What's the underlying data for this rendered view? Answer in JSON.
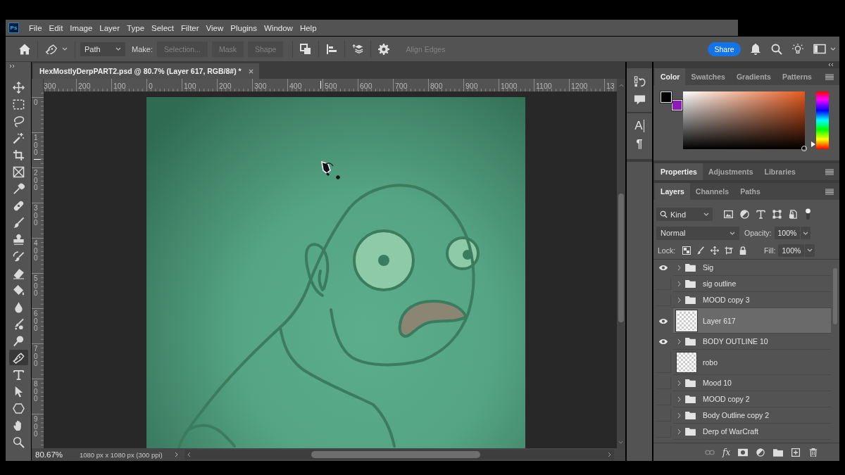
{
  "menu_bar": {
    "logo": "Ps",
    "items": [
      "File",
      "Edit",
      "Image",
      "Layer",
      "Type",
      "Select",
      "Filter",
      "View",
      "Plugins",
      "Window",
      "Help"
    ]
  },
  "options_bar": {
    "mode": "Path",
    "make_label": "Make:",
    "make_buttons": [
      {
        "label": "Selection...",
        "disabled": true
      },
      {
        "label": "Mask",
        "disabled": true
      },
      {
        "label": "Shape",
        "disabled": true
      }
    ],
    "align_edges": {
      "label": "Align Edges",
      "disabled": true
    },
    "share": "Share"
  },
  "tools": [
    {
      "kind": "move",
      "selected": false
    },
    {
      "kind": "marquee",
      "selected": false
    },
    {
      "kind": "lasso",
      "selected": false
    },
    {
      "kind": "wand",
      "selected": false
    },
    {
      "kind": "crop",
      "selected": false
    },
    {
      "kind": "frame",
      "selected": false
    },
    {
      "kind": "eyedropper",
      "selected": false
    },
    {
      "kind": "healing",
      "selected": false
    },
    {
      "kind": "brush",
      "selected": false
    },
    {
      "kind": "stamp",
      "selected": false
    },
    {
      "kind": "history_brush",
      "selected": false
    },
    {
      "kind": "eraser",
      "selected": false
    },
    {
      "kind": "bucket",
      "selected": false
    },
    {
      "kind": "blur",
      "selected": false
    },
    {
      "kind": "smudge",
      "selected": false
    },
    {
      "kind": "dodge",
      "selected": false
    },
    {
      "kind": "pen",
      "selected": true
    },
    {
      "kind": "type",
      "selected": false
    },
    {
      "kind": "path_select",
      "selected": false
    },
    {
      "kind": "shape",
      "selected": false
    },
    {
      "kind": "hand",
      "selected": false
    },
    {
      "kind": "zoom",
      "selected": false
    }
  ],
  "document": {
    "tab": "HexMostlyDerpPART2.psd @ 80.7% (Layer 617, RGB/8#) *",
    "ruler_h": [
      "300",
      "200",
      "100",
      "0",
      "100",
      "200",
      "300",
      "400",
      "500",
      "600",
      "700",
      "800",
      "900",
      "1000",
      "1100",
      "1200",
      "13"
    ],
    "ruler_v": [
      "0",
      "100",
      "200",
      "300",
      "400",
      "500",
      "600",
      "700",
      "800",
      "900"
    ]
  },
  "status_bar": {
    "zoom": "80.67%",
    "info": "1080 px x 1080 px (300 ppi)"
  },
  "panel_strip": [
    {
      "kind": "history"
    },
    {
      "kind": "comments"
    },
    {
      "kind": "character",
      "glyph": "A"
    },
    {
      "kind": "paragraph",
      "glyph": "¶"
    }
  ],
  "color_panel": {
    "tabs": [
      {
        "label": "Color",
        "selected": true
      },
      {
        "label": "Swatches",
        "selected": false
      },
      {
        "label": "Gradients",
        "selected": false
      },
      {
        "label": "Patterns",
        "selected": false
      }
    ],
    "swatches": [
      {
        "kind": "foreground",
        "color": "#000000"
      },
      {
        "kind": "background",
        "color": "#8c1cb8"
      }
    ],
    "hue_slider": {
      "level": 0.08
    }
  },
  "properties_panel": {
    "tabs": [
      {
        "label": "Properties",
        "selected": true
      },
      {
        "label": "Adjustments",
        "selected": false
      },
      {
        "label": "Libraries",
        "selected": false
      }
    ]
  },
  "layers_panel": {
    "tabs": [
      {
        "label": "Layers",
        "selected": true
      },
      {
        "label": "Channels",
        "selected": false
      },
      {
        "label": "Paths",
        "selected": false
      }
    ],
    "filter": "Kind",
    "blend_mode": "Normal",
    "opacity_label": "Opacity:",
    "opacity": "100%",
    "lock_label": "Lock:",
    "fill_label": "Fill:",
    "fill": "100%",
    "layers": [
      {
        "name": "Sig",
        "kind": "group",
        "visible": true,
        "selected": false
      },
      {
        "name": "sig outline",
        "kind": "group",
        "visible": false,
        "selected": false
      },
      {
        "name": "MOOD copy 3",
        "kind": "group",
        "visible": false,
        "selected": false
      },
      {
        "name": "Layer 617",
        "kind": "pixel",
        "visible": true,
        "selected": true
      },
      {
        "name": "BODY OUTLINE 10",
        "kind": "group",
        "visible": true,
        "selected": false
      },
      {
        "name": "robo",
        "kind": "pixel",
        "visible": false,
        "selected": false
      },
      {
        "name": "Mood 10",
        "kind": "group",
        "visible": false,
        "selected": false
      },
      {
        "name": "MOOD copy 2",
        "kind": "group",
        "visible": false,
        "selected": false
      },
      {
        "name": "Body Outline copy 2",
        "kind": "group",
        "visible": false,
        "selected": false
      },
      {
        "name": "Derp of WarCraft",
        "kind": "group",
        "visible": false,
        "selected": false
      }
    ],
    "fx": "fx"
  }
}
